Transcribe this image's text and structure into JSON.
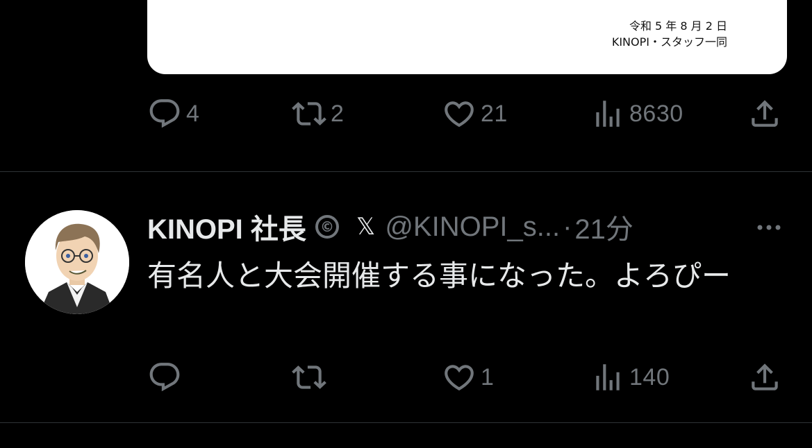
{
  "prev_tweet": {
    "card": {
      "date_line": "令和 5 年 8 月 2 日",
      "signature_line": "KINOPI・スタッフ一同"
    },
    "actions": {
      "replies": "4",
      "retweets": "2",
      "likes": "21",
      "views": "8630"
    }
  },
  "tweet": {
    "author_name": "KINOPI 社長",
    "badge_symbol": "©",
    "x_symbol": "𝕏",
    "handle": "@KINOPI_s...",
    "separator": "·",
    "time": "21分",
    "text": "有名人と大会開催する事になった。よろぴー",
    "actions": {
      "replies": "",
      "retweets": "",
      "likes": "1",
      "views": "140"
    }
  },
  "icons": [
    "reply-icon",
    "retweet-icon",
    "like-icon",
    "views-icon",
    "share-icon",
    "more-icon",
    "verified-badge-icon",
    "x-logo-icon"
  ],
  "colors": {
    "background": "#000000",
    "text": "#e7e9ea",
    "muted": "#71767b",
    "divider": "#2f3336"
  }
}
